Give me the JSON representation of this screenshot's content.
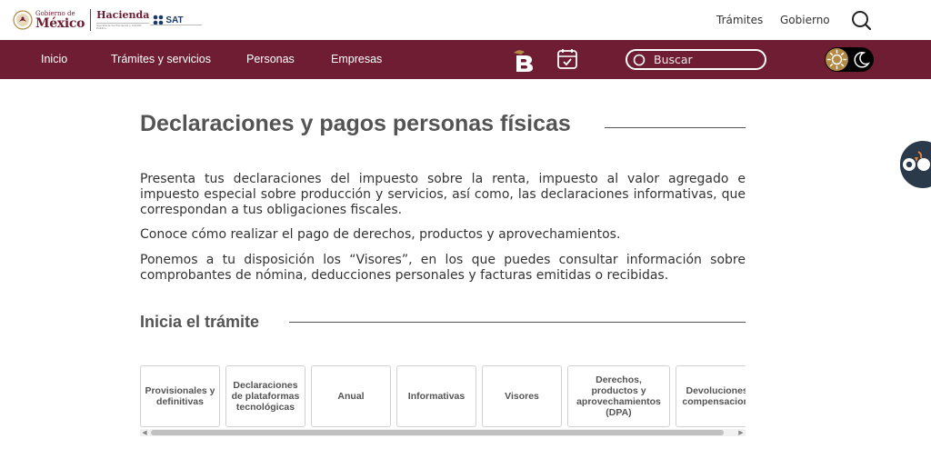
{
  "header": {
    "gobierno_small": "Gobierno de",
    "gobierno_big": "México",
    "hacienda": "Hacienda",
    "hacienda_sub": "Secretaría de Hacienda y Crédito Público",
    "sat": "SAT",
    "links": [
      "Trámites",
      "Gobierno"
    ],
    "icons": {
      "search": "search-icon",
      "eagle": "eagle-seal-icon"
    }
  },
  "nav": {
    "items": [
      "Inicio",
      "Trámites y servicios",
      "Personas",
      "Empresas"
    ],
    "search_placeholder": "Buscar",
    "icons": {
      "brand": "b-logo-icon",
      "calendar": "calendar-check-icon",
      "sun": "sun-icon",
      "moon": "moon-icon"
    }
  },
  "main": {
    "title": "Declaraciones y pagos personas físicas",
    "paragraphs": [
      "Presenta tus declaraciones del impuesto sobre la renta, impuesto al valor agregado e impuesto especial sobre producción y servicios, así como, las declaraciones informativas, que correspondan a tus obligaciones fiscales.",
      "Conoce cómo realizar el pago de derechos, productos y aprovechamientos.",
      "Ponemos a tu disposición los “Visores”, en los que puedes consultar información sobre comprobantes de nómina, deducciones personales y facturas emitidas o recibidas."
    ],
    "section_title": "Inicia el trámite",
    "cards": [
      "Provisionales y definitivas",
      "Declaraciones de plataformas tecnológicas",
      "Anual",
      "Informativas",
      "Visores",
      "Derechos, productos y aprovechamientos (DPA)",
      "Devoluciones y compensaciones"
    ]
  },
  "scrollbar": {
    "left_arrow": "◀",
    "right_arrow": "▶"
  },
  "colors": {
    "brand": "#6f1d33",
    "accent": "#b28a45",
    "text": "#333333",
    "heading": "#545454"
  },
  "widgets": {
    "accessibility": "accessibility-owl-icon"
  }
}
